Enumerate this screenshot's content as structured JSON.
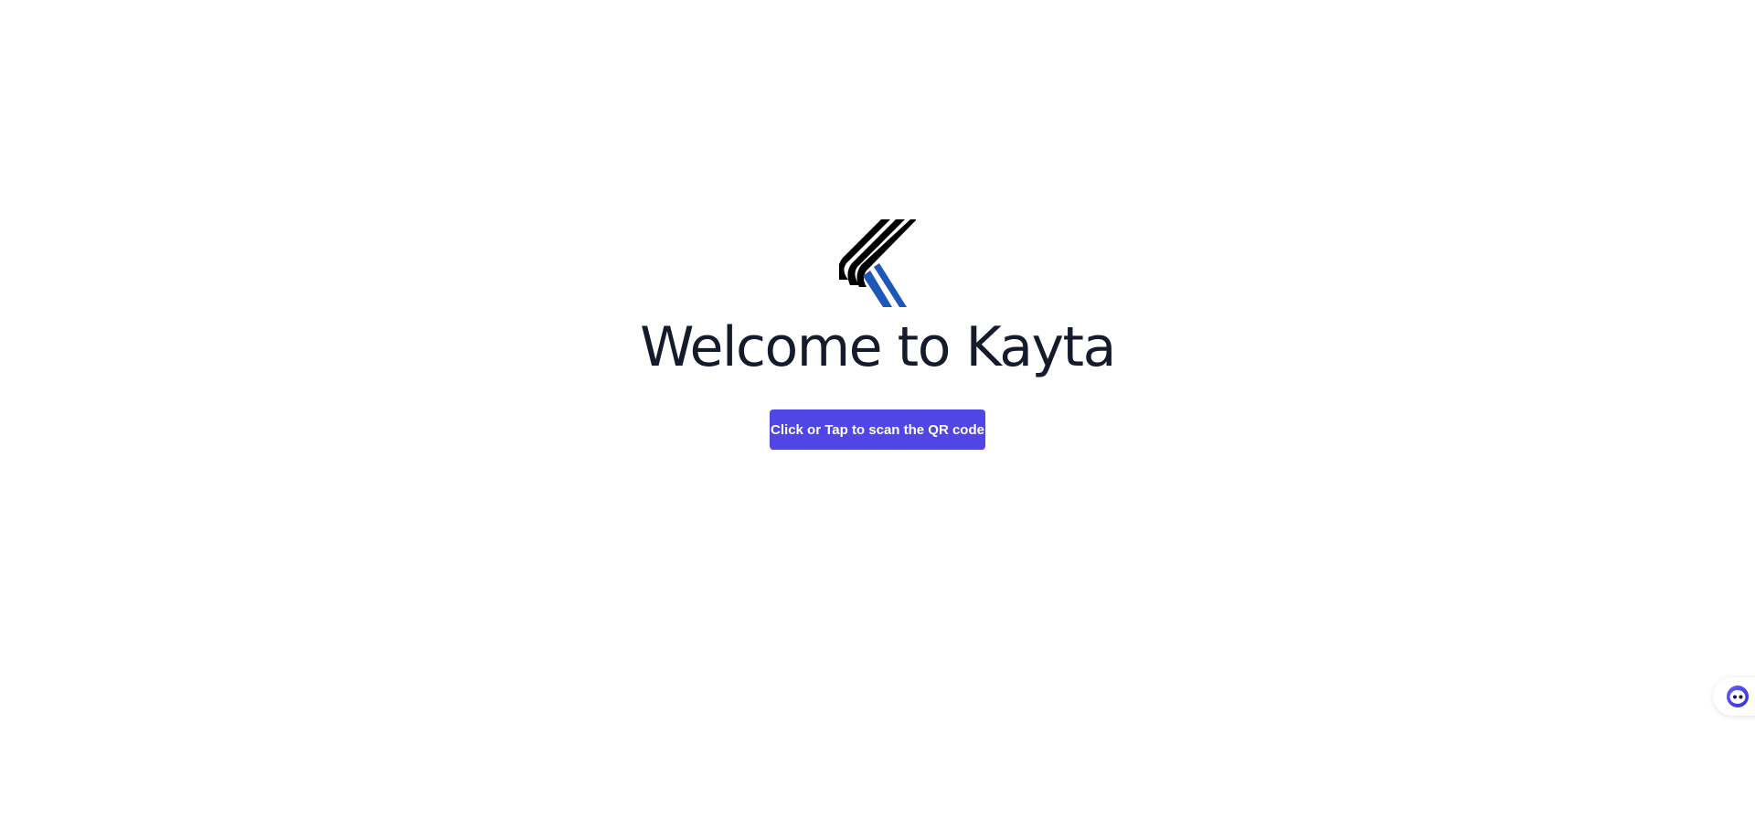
{
  "brand": {
    "logo_icon": "kayta-logo-icon",
    "colors": {
      "logo_black": "#000000",
      "logo_blue": "#1d57b8",
      "accent": "#4f46e5",
      "title": "#161b2c"
    }
  },
  "main": {
    "title": "Welcome to Kayta",
    "scan_button_label": "Click or Tap to scan the QR code"
  },
  "chat_widget": {
    "icon": "chat-assistant-icon"
  }
}
